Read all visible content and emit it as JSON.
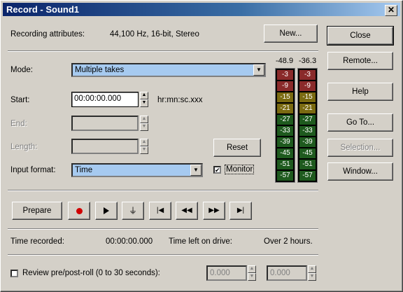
{
  "window": {
    "title": "Record - Sound1",
    "close_glyph": "✕"
  },
  "attributes": {
    "label": "Recording attributes:",
    "value": "44,100 Hz, 16-bit, Stereo",
    "new_button": "New..."
  },
  "mode": {
    "label": "Mode:",
    "value": "Multiple takes"
  },
  "start": {
    "label": "Start:",
    "value": "00:00:00.000",
    "format": "hr:mn:sc.xxx"
  },
  "end": {
    "label": "End:",
    "value": ""
  },
  "length": {
    "label": "Length:",
    "value": ""
  },
  "input_format": {
    "label": "Input format:",
    "value": "Time"
  },
  "reset_button": "Reset",
  "monitor": {
    "label": "Monitor",
    "checked": true,
    "mark": "✔"
  },
  "meters": {
    "left_peak": "-48.9",
    "right_peak": "-36.3",
    "scale": [
      "-3",
      "-9",
      "-15",
      "-21",
      "-27",
      "-33",
      "-39",
      "-45",
      "-51",
      "-57"
    ]
  },
  "side_buttons": {
    "close": "Close",
    "remote": "Remote...",
    "help": "Help",
    "goto": "Go To...",
    "selection": "Selection...",
    "window": "Window..."
  },
  "transport": {
    "prepare": "Prepare",
    "record_icon": "record-icon",
    "play_icon": "play-icon",
    "pause_icon": "pause-icon",
    "start_icon": "go-to-start-icon",
    "rewind_icon": "rewind-icon",
    "forward_icon": "fast-forward-icon",
    "end_icon": "go-to-end-icon"
  },
  "status": {
    "recorded_label": "Time recorded:",
    "recorded_value": "00:00:00.000",
    "left_label": "Time left on drive:",
    "left_value": "Over 2 hours."
  },
  "review": {
    "label": "Review pre/post-roll (0 to 30 seconds):",
    "pre": "0.000",
    "post": "0.000"
  }
}
